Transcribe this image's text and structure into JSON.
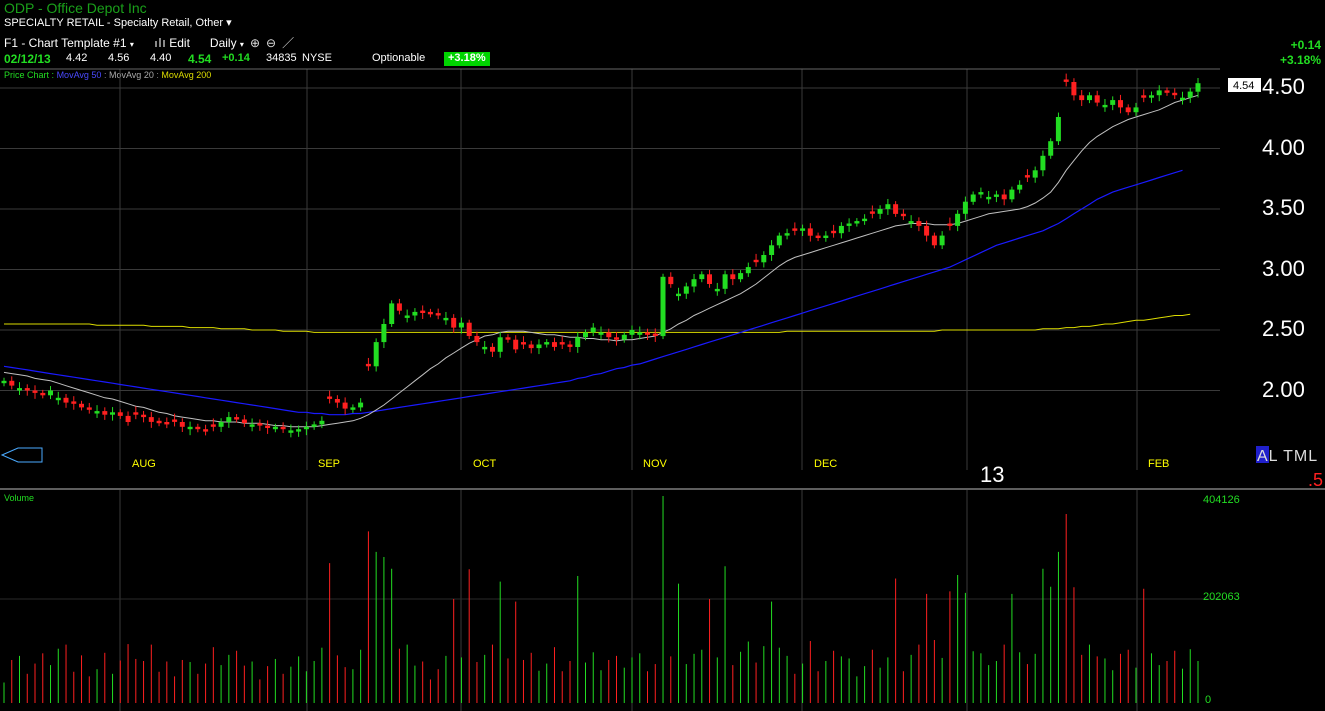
{
  "header": {
    "symbol": "ODP",
    "company": "- Office Depot Inc",
    "sector": "SPECIALTY RETAIL - Specialty Retail, Other",
    "sector_caret": "▾"
  },
  "toolbar": {
    "template": "F1 - Chart Template #1",
    "edit": "Edit",
    "period": "Daily",
    "caret": "▾",
    "zoom_in": "⊕",
    "zoom_out": "⊖",
    "draw": "／"
  },
  "quote": {
    "date": "02/12/13",
    "open": "4.42",
    "high": "4.56",
    "low": "4.40",
    "close": "4.54",
    "change": "+0.14",
    "volume": "34835",
    "exchange": "NYSE",
    "optionable": "Optionable",
    "pct": "+3.18%"
  },
  "change_corner": {
    "change": "+0.14",
    "pct": "+3.18%"
  },
  "studies": {
    "price_chart": "Price Chart",
    "ma50": "MovAvg 50",
    "ma20": "MovAvg 20",
    "ma200": "MovAvg 200",
    "sep": ":"
  },
  "price_axis": {
    "labels": [
      "4.50",
      "4.00",
      "3.50",
      "3.00",
      "2.50",
      "2.00"
    ],
    "last_price": "4.54"
  },
  "months": [
    "AUG",
    "SEP",
    "OCT",
    "NOV",
    "DEC",
    "13",
    "FEB"
  ],
  "brand": {
    "logo": "AL TML",
    "extra": ".5"
  },
  "volume_panel": {
    "label": "Volume",
    "ticks": [
      "404126",
      "202063",
      "0"
    ]
  },
  "colors": {
    "up": "#22dd22",
    "down": "#ff2020",
    "ma20": "#c0c0c0",
    "ma50": "#1a1aff",
    "ma200": "#dddd00",
    "grid": "#3a3a3a",
    "label_yellow": "#ffff00"
  },
  "chart_data": {
    "type": "candlestick",
    "price_ylim": [
      1.5,
      4.7
    ],
    "volume_ylim": [
      0,
      404126
    ],
    "grid": true,
    "months": [
      "AUG",
      "SEP",
      "OCT",
      "NOV",
      "DEC",
      "13",
      "FEB"
    ],
    "closes": [
      2.08,
      2.04,
      2.02,
      2.0,
      1.98,
      1.96,
      2.0,
      1.94,
      1.9,
      1.89,
      1.86,
      1.84,
      1.83,
      1.8,
      1.82,
      1.79,
      1.74,
      1.8,
      1.78,
      1.74,
      1.73,
      1.72,
      1.74,
      1.7,
      1.7,
      1.68,
      1.66,
      1.7,
      1.74,
      1.78,
      1.76,
      1.73,
      1.72,
      1.71,
      1.69,
      1.7,
      1.68,
      1.67,
      1.68,
      1.7,
      1.72,
      1.75,
      1.93,
      1.9,
      1.85,
      1.86,
      1.9,
      2.2,
      2.4,
      2.55,
      2.72,
      2.66,
      2.62,
      2.65,
      2.64,
      2.63,
      2.62,
      2.6,
      2.52,
      2.56,
      2.45,
      2.4,
      2.36,
      2.32,
      2.44,
      2.42,
      2.34,
      2.38,
      2.35,
      2.38,
      2.4,
      2.36,
      2.38,
      2.36,
      2.44,
      2.48,
      2.52,
      2.48,
      2.44,
      2.42,
      2.46,
      2.5,
      2.48,
      2.46,
      2.45,
      2.94,
      2.88,
      2.8,
      2.86,
      2.92,
      2.96,
      2.88,
      2.84,
      2.96,
      2.92,
      2.97,
      3.02,
      3.06,
      3.12,
      3.2,
      3.28,
      3.3,
      3.32,
      3.34,
      3.28,
      3.26,
      3.28,
      3.3,
      3.36,
      3.38,
      3.4,
      3.42,
      3.46,
      3.5,
      3.54,
      3.46,
      3.44,
      3.4,
      3.36,
      3.28,
      3.2,
      3.28,
      3.36,
      3.46,
      3.56,
      3.62,
      3.64,
      3.6,
      3.62,
      3.58,
      3.66,
      3.7,
      3.76,
      3.82,
      3.94,
      4.06,
      4.26,
      4.55,
      4.44,
      4.4,
      4.44,
      4.38,
      4.36,
      4.4,
      4.34,
      4.3,
      4.34,
      4.42,
      4.44,
      4.48,
      4.46,
      4.44,
      4.42,
      4.47,
      4.54
    ],
    "ma20": [
      2.15,
      2.14,
      2.13,
      2.12,
      2.1,
      2.09,
      2.08,
      2.06,
      2.04,
      2.02,
      2.0,
      1.98,
      1.96,
      1.94,
      1.93,
      1.91,
      1.89,
      1.87,
      1.86,
      1.84,
      1.82,
      1.81,
      1.79,
      1.78,
      1.77,
      1.76,
      1.75,
      1.75,
      1.74,
      1.74,
      1.74,
      1.73,
      1.73,
      1.73,
      1.72,
      1.71,
      1.71,
      1.7,
      1.7,
      1.7,
      1.7,
      1.71,
      1.72,
      1.73,
      1.74,
      1.75,
      1.77,
      1.8,
      1.84,
      1.88,
      1.93,
      1.98,
      2.03,
      2.08,
      2.13,
      2.18,
      2.22,
      2.27,
      2.31,
      2.35,
      2.39,
      2.42,
      2.45,
      2.46,
      2.48,
      2.49,
      2.49,
      2.49,
      2.48,
      2.47,
      2.46,
      2.46,
      2.45,
      2.44,
      2.44,
      2.43,
      2.43,
      2.42,
      2.42,
      2.41,
      2.42,
      2.42,
      2.43,
      2.44,
      2.45,
      2.48,
      2.51,
      2.55,
      2.58,
      2.62,
      2.65,
      2.68,
      2.71,
      2.74,
      2.77,
      2.8,
      2.84,
      2.88,
      2.93,
      2.98,
      3.03,
      3.07,
      3.1,
      3.12,
      3.14,
      3.16,
      3.18,
      3.2,
      3.22,
      3.24,
      3.26,
      3.28,
      3.3,
      3.32,
      3.34,
      3.36,
      3.37,
      3.38,
      3.38,
      3.38,
      3.37,
      3.37,
      3.37,
      3.38,
      3.4,
      3.42,
      3.44,
      3.46,
      3.47,
      3.48,
      3.49,
      3.5,
      3.52,
      3.55,
      3.59,
      3.64,
      3.72,
      3.82,
      3.9,
      3.98,
      4.05,
      4.1,
      4.14,
      4.18,
      4.21,
      4.24,
      4.26,
      4.28,
      4.3,
      4.32,
      4.35,
      4.38,
      4.4,
      4.42,
      4.44
    ],
    "ma50": [
      2.2,
      2.19,
      2.18,
      2.17,
      2.16,
      2.15,
      2.14,
      2.13,
      2.12,
      2.11,
      2.1,
      2.09,
      2.08,
      2.07,
      2.06,
      2.05,
      2.04,
      2.03,
      2.02,
      2.01,
      2.0,
      1.99,
      1.98,
      1.97,
      1.96,
      1.95,
      1.94,
      1.93,
      1.92,
      1.91,
      1.9,
      1.89,
      1.88,
      1.87,
      1.86,
      1.85,
      1.84,
      1.83,
      1.82,
      1.82,
      1.81,
      1.81,
      1.8,
      1.8,
      1.8,
      1.81,
      1.81,
      1.82,
      1.83,
      1.84,
      1.85,
      1.86,
      1.87,
      1.88,
      1.89,
      1.9,
      1.91,
      1.92,
      1.93,
      1.94,
      1.95,
      1.96,
      1.97,
      1.98,
      1.99,
      2.0,
      2.01,
      2.02,
      2.03,
      2.04,
      2.05,
      2.06,
      2.07,
      2.08,
      2.1,
      2.11,
      2.13,
      2.14,
      2.16,
      2.18,
      2.19,
      2.21,
      2.22,
      2.24,
      2.26,
      2.28,
      2.3,
      2.32,
      2.34,
      2.36,
      2.38,
      2.4,
      2.42,
      2.44,
      2.46,
      2.48,
      2.5,
      2.52,
      2.54,
      2.56,
      2.58,
      2.6,
      2.62,
      2.64,
      2.66,
      2.68,
      2.7,
      2.72,
      2.74,
      2.76,
      2.78,
      2.8,
      2.82,
      2.84,
      2.86,
      2.88,
      2.9,
      2.92,
      2.94,
      2.96,
      2.98,
      3.0,
      3.02,
      3.05,
      3.08,
      3.11,
      3.14,
      3.17,
      3.2,
      3.22,
      3.24,
      3.26,
      3.28,
      3.3,
      3.32,
      3.35,
      3.38,
      3.42,
      3.46,
      3.5,
      3.54,
      3.58,
      3.61,
      3.64,
      3.66,
      3.68,
      3.7,
      3.72,
      3.74,
      3.76,
      3.78,
      3.8,
      3.82
    ],
    "ma200": [
      2.55,
      2.55,
      2.55,
      2.55,
      2.55,
      2.55,
      2.55,
      2.55,
      2.55,
      2.55,
      2.55,
      2.55,
      2.54,
      2.54,
      2.54,
      2.54,
      2.54,
      2.54,
      2.54,
      2.53,
      2.53,
      2.53,
      2.53,
      2.53,
      2.52,
      2.52,
      2.52,
      2.52,
      2.51,
      2.51,
      2.51,
      2.51,
      2.5,
      2.5,
      2.5,
      2.5,
      2.49,
      2.49,
      2.49,
      2.49,
      2.48,
      2.48,
      2.48,
      2.48,
      2.48,
      2.48,
      2.48,
      2.48,
      2.48,
      2.48,
      2.48,
      2.48,
      2.48,
      2.48,
      2.48,
      2.48,
      2.48,
      2.48,
      2.48,
      2.48,
      2.48,
      2.48,
      2.48,
      2.48,
      2.48,
      2.48,
      2.48,
      2.48,
      2.48,
      2.48,
      2.48,
      2.48,
      2.48,
      2.48,
      2.48,
      2.48,
      2.48,
      2.48,
      2.48,
      2.48,
      2.48,
      2.48,
      2.48,
      2.48,
      2.48,
      2.48,
      2.48,
      2.48,
      2.48,
      2.48,
      2.48,
      2.48,
      2.48,
      2.48,
      2.48,
      2.48,
      2.48,
      2.48,
      2.48,
      2.48,
      2.48,
      2.49,
      2.49,
      2.49,
      2.49,
      2.49,
      2.49,
      2.49,
      2.49,
      2.49,
      2.49,
      2.49,
      2.49,
      2.49,
      2.49,
      2.49,
      2.49,
      2.49,
      2.49,
      2.49,
      2.49,
      2.5,
      2.5,
      2.5,
      2.5,
      2.5,
      2.5,
      2.5,
      2.5,
      2.5,
      2.5,
      2.5,
      2.5,
      2.5,
      2.51,
      2.51,
      2.51,
      2.52,
      2.52,
      2.53,
      2.53,
      2.54,
      2.55,
      2.55,
      2.56,
      2.57,
      2.58,
      2.58,
      2.59,
      2.6,
      2.61,
      2.62,
      2.62,
      2.63
    ]
  }
}
